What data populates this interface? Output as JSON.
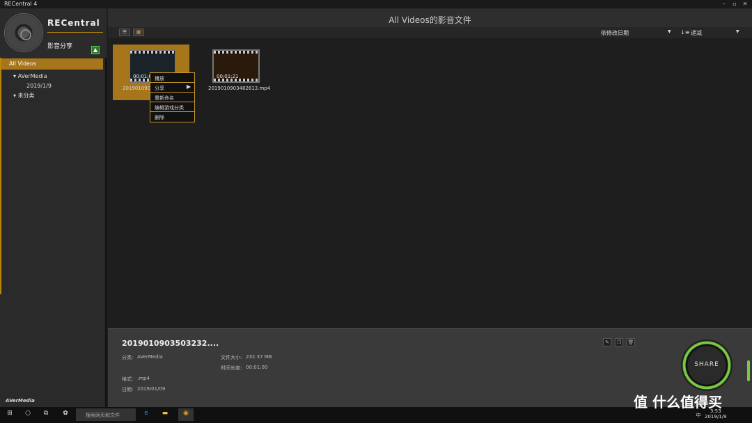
{
  "app": {
    "title": "RECentral 4",
    "brand": "RECentral",
    "section": "影音分享",
    "vendor": "AVerMedia"
  },
  "window_controls": {
    "minimize": "–",
    "maximize": "▫",
    "close": "✕"
  },
  "sidebar": {
    "selected": "All Videos",
    "tree": [
      {
        "label": "AVerMedia",
        "expanded": true,
        "children": [
          "2019/1/9"
        ]
      },
      {
        "label": "未分类",
        "expanded": true,
        "children": []
      }
    ]
  },
  "header": {
    "title": "All Videos的影音文件"
  },
  "toolbar": {
    "sort_by": "依修改日期",
    "order": "递减",
    "view": "grid"
  },
  "videos": [
    {
      "name": "2019010903503232.mp4",
      "name_display": "20190109035",
      "duration": "00:01:00",
      "selected": true
    },
    {
      "name": "2019010903482613.mp4",
      "duration": "00:01:21",
      "selected": false
    }
  ],
  "context_menu": {
    "items": [
      "播放",
      "分享",
      "重新命名",
      "编辑游戏分类",
      "删除"
    ]
  },
  "details": {
    "title": "2019010903503232....",
    "category_label": "分类:",
    "category": "AVerMedia",
    "format_label": "格式:",
    "format": ".mp4",
    "date_label": "日期:",
    "date": "2019/01/09",
    "size_label": "文件大小:",
    "size": "232.37 MB",
    "length_label": "时间长度:",
    "length": "00:01:00",
    "share_label": "SHARE"
  },
  "taskbar": {
    "search_placeholder": "搜索网页和文件",
    "time": "3:53",
    "date": "2019/1/9",
    "ime": "中"
  },
  "watermark": "值 什么值得买",
  "colors": {
    "accent": "#a7751a",
    "share_ring": "#7ac943"
  }
}
